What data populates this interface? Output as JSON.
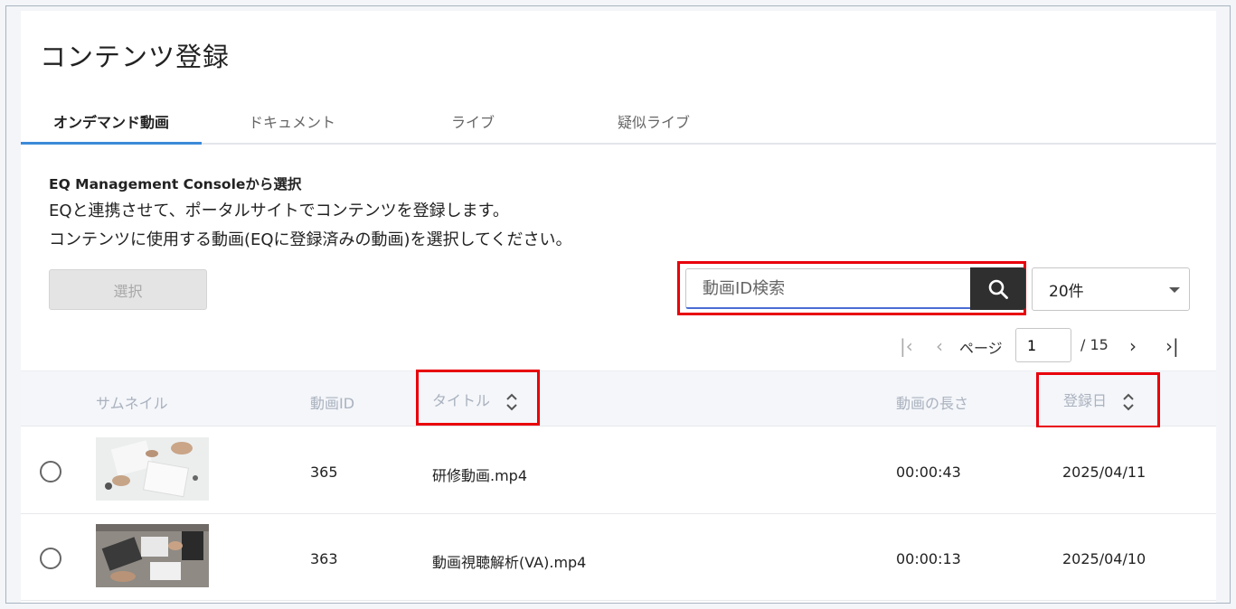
{
  "page": {
    "title": "コンテンツ登録"
  },
  "tabs": [
    {
      "label": "オンデマンド動画",
      "active": true
    },
    {
      "label": "ドキュメント",
      "active": false
    },
    {
      "label": "ライブ",
      "active": false
    },
    {
      "label": "疑似ライブ",
      "active": false
    }
  ],
  "description": {
    "heading": "EQ Management Consoleから選択",
    "line1": "EQと連携させて、ポータルサイトでコンテンツを登録します。",
    "line2": "コンテンツに使用する動画(EQに登録済みの動画)を選択してください。"
  },
  "toolbar": {
    "select_label": "選択",
    "search_placeholder": "動画ID検索",
    "per_page": "20件"
  },
  "pager": {
    "label": "ページ",
    "current": "1",
    "total": "/ 15"
  },
  "table": {
    "headers": {
      "thumbnail": "サムネイル",
      "video_id": "動画ID",
      "title": "タイトル",
      "duration": "動画の長さ",
      "registered": "登録日"
    },
    "rows": [
      {
        "id": "365",
        "title": "研修動画.mp4",
        "duration": "00:00:43",
        "date": "2025/04/11"
      },
      {
        "id": "363",
        "title": "動画視聴解析(VA).mp4",
        "duration": "00:00:13",
        "date": "2025/04/10"
      }
    ]
  },
  "colors": {
    "accent": "#3c8ad8",
    "highlight": "#e8000b",
    "search_button": "#2f2f2f"
  }
}
